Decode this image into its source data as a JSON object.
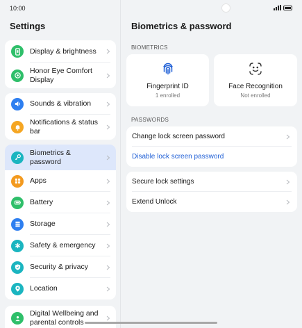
{
  "status_bar": {
    "time": "10:00"
  },
  "settings": {
    "title": "Settings",
    "groups": [
      {
        "items": [
          {
            "label": "Display & brightness",
            "icon": "display-icon",
            "color": "#2fbf6a"
          },
          {
            "label": "Honor Eye Comfort Display",
            "icon": "eye-comfort-icon",
            "color": "#2fbf6a"
          }
        ]
      },
      {
        "items": [
          {
            "label": "Sounds & vibration",
            "icon": "speaker-icon",
            "color": "#2e7ff0"
          },
          {
            "label": "Notifications & status bar",
            "icon": "bell-icon",
            "color": "#f5a623"
          }
        ]
      },
      {
        "items": [
          {
            "label": "Biometrics & password",
            "icon": "key-icon",
            "color": "#1bb5c0",
            "selected": true
          },
          {
            "label": "Apps",
            "icon": "apps-icon",
            "color": "#f39a1f"
          },
          {
            "label": "Battery",
            "icon": "battery-icon",
            "color": "#2fbf6a"
          },
          {
            "label": "Storage",
            "icon": "storage-icon",
            "color": "#2e7ff0"
          },
          {
            "label": "Safety & emergency",
            "icon": "asterisk-icon",
            "color": "#1bb5c0"
          },
          {
            "label": "Security & privacy",
            "icon": "shield-icon",
            "color": "#1bb5c0"
          },
          {
            "label": "Location",
            "icon": "location-pin-icon",
            "color": "#1bb5c0"
          }
        ]
      },
      {
        "items": [
          {
            "label": "Digital Wellbeing and parental controls",
            "icon": "wellbeing-icon",
            "color": "#2fbf6a"
          }
        ]
      }
    ]
  },
  "detail": {
    "title": "Biometrics & password",
    "biometrics_label": "BIOMETRICS",
    "fingerprint": {
      "name": "Fingerprint ID",
      "status": "1 enrolled",
      "icon": "fingerprint-icon",
      "color": "#1f5fd6"
    },
    "face": {
      "name": "Face Recognition",
      "status": "Not enrolled",
      "icon": "face-icon",
      "color": "#333333"
    },
    "passwords_label": "PASSWORDS",
    "password_rows": [
      {
        "label": "Change lock screen password"
      },
      {
        "label": "Disable lock screen password"
      }
    ],
    "other_rows": [
      {
        "label": "Secure lock settings"
      },
      {
        "label": "Extend Unlock"
      }
    ],
    "link_color": "#1f5fd6"
  }
}
